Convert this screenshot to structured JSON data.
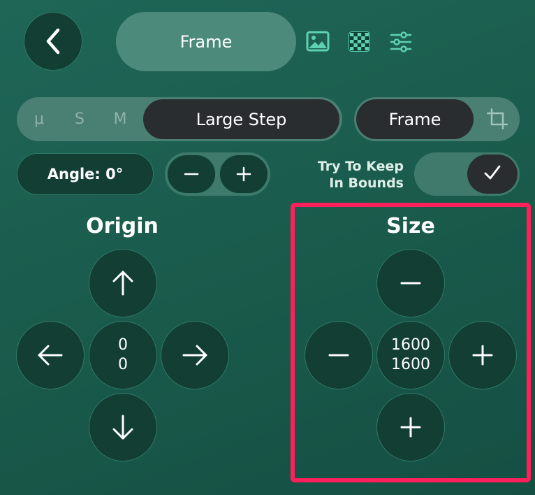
{
  "header": {
    "title": "Frame",
    "icons": [
      "back-chevron-icon",
      "image-icon",
      "checkerboard-icon",
      "sliders-icon"
    ]
  },
  "step_segment": {
    "options": [
      "μ",
      "S",
      "M",
      "Large Step"
    ],
    "selected": "Large Step"
  },
  "frame_toggle": {
    "label": "Frame"
  },
  "angle": {
    "label": "Angle: 0°"
  },
  "keep_in_bounds": {
    "label_line1": "Try To Keep",
    "label_line2": "In Bounds",
    "checked": true
  },
  "origin": {
    "heading": "Origin",
    "x": "0",
    "y": "0"
  },
  "size": {
    "heading": "Size",
    "width": "1600",
    "height": "1600"
  },
  "colors": {
    "background": "#1d5f50",
    "button_dark": "#123e33",
    "selected_segment": "#2a2d2f",
    "accent_icon": "#5fd1b3",
    "highlight": "#ff1f5a"
  }
}
